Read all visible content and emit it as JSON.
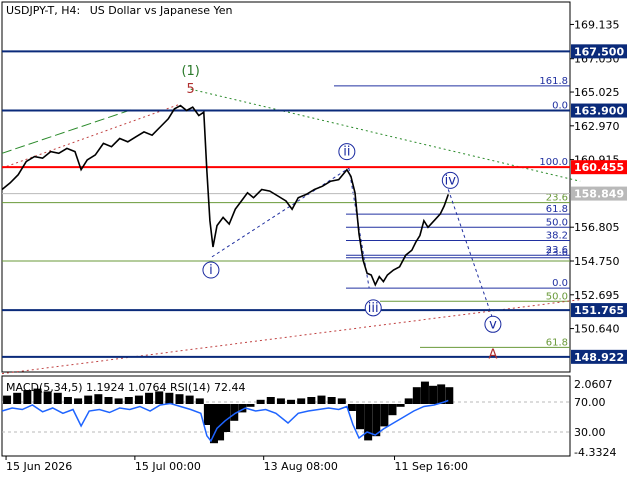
{
  "header": {
    "symbol": "USDJPY-T, H4:",
    "description": "US Dollar vs Japanese Yen"
  },
  "chart_data": {
    "type": "line",
    "title": "USDJPY-T, H4:  US Dollar vs Japanese Yen",
    "price_axis": {
      "ylim": [
        148.0,
        170.5
      ],
      "ticks": [
        {
          "label": "169.135",
          "value": 169.135
        },
        {
          "label": "167.050",
          "value": 167.05
        },
        {
          "label": "165.025",
          "value": 165.025
        },
        {
          "label": "162.970",
          "value": 162.97
        },
        {
          "label": "160.915",
          "value": 160.915
        },
        {
          "label": "156.805",
          "value": 156.805
        },
        {
          "label": "154.750",
          "value": 154.75
        },
        {
          "label": "152.695",
          "value": 152.695
        },
        {
          "label": "150.640",
          "value": 150.64
        }
      ]
    },
    "time_axis": {
      "xlim": [
        0,
        560
      ],
      "ticks": [
        {
          "label": "15 Jun 2026",
          "x": 4
        },
        {
          "label": "15 Jul 00:00",
          "x": 131
        },
        {
          "label": "13 Aug 08:00",
          "x": 258
        },
        {
          "label": "11 Sep 16:00",
          "x": 387
        }
      ]
    },
    "levels": [
      {
        "label": "167.500",
        "value": 167.5,
        "color": "#0a2a7a"
      },
      {
        "label": "163.900",
        "value": 163.9,
        "color": "#0a2a7a"
      },
      {
        "label": "160.455",
        "value": 160.455,
        "color": "#ff0000"
      },
      {
        "label": "158.849",
        "value": 158.849,
        "color": "#b9b9b9"
      },
      {
        "label": "151.765",
        "value": 151.765,
        "color": "#0a2a7a"
      },
      {
        "label": "148.922",
        "value": 148.922,
        "color": "#0a2a7a"
      }
    ],
    "fib_extension": [
      {
        "label": "161.8",
        "value": 165.4
      },
      {
        "label": "0.0",
        "value": 163.9
      },
      {
        "label": "100.0",
        "value": 160.455
      }
    ],
    "fib_retracement": [
      {
        "label": "23.6",
        "value": 158.3
      },
      {
        "label": "61.8",
        "value": 157.6
      },
      {
        "label": "50.0",
        "value": 156.8
      },
      {
        "label": "38.2",
        "value": 156.0
      },
      {
        "label": "23.6",
        "value": 155.1
      },
      {
        "label": "23.6",
        "value": 154.95
      },
      {
        "label": "0.0",
        "value": 153.1
      }
    ],
    "fib_lower": [
      {
        "label": "50.0",
        "value": 152.3
      },
      {
        "label": "61.8",
        "value": 149.5
      }
    ],
    "wave_labels": [
      {
        "text": "(1)",
        "x": 186,
        "y": 166.3,
        "color": "#2a7a2a"
      },
      {
        "text": "5",
        "x": 186,
        "y": 165.2,
        "color": "#b03030"
      },
      {
        "text": "ii",
        "x": 340,
        "y": 161.4,
        "color": "#1a2aa0"
      },
      {
        "text": "i",
        "x": 206,
        "y": 154.2,
        "color": "#1a2aa0"
      },
      {
        "text": "iv",
        "x": 442,
        "y": 159.65,
        "color": "#1a2aa0"
      },
      {
        "text": "iii",
        "x": 366,
        "y": 151.9,
        "color": "#1a2aa0"
      },
      {
        "text": "v",
        "x": 484,
        "y": 150.9,
        "color": "#1a2aa0"
      },
      {
        "text": "A",
        "x": 484,
        "y": 149.05,
        "color": "#b03030"
      }
    ],
    "price_series": [
      {
        "x": 0,
        "y": 159.1
      },
      {
        "x": 8,
        "y": 159.5
      },
      {
        "x": 16,
        "y": 160.0
      },
      {
        "x": 24,
        "y": 160.8
      },
      {
        "x": 32,
        "y": 161.1
      },
      {
        "x": 40,
        "y": 161.0
      },
      {
        "x": 48,
        "y": 161.4
      },
      {
        "x": 56,
        "y": 161.3
      },
      {
        "x": 64,
        "y": 161.6
      },
      {
        "x": 72,
        "y": 161.4
      },
      {
        "x": 78,
        "y": 160.3
      },
      {
        "x": 84,
        "y": 160.9
      },
      {
        "x": 92,
        "y": 161.2
      },
      {
        "x": 100,
        "y": 161.9
      },
      {
        "x": 108,
        "y": 161.7
      },
      {
        "x": 116,
        "y": 162.2
      },
      {
        "x": 124,
        "y": 162.0
      },
      {
        "x": 132,
        "y": 162.3
      },
      {
        "x": 140,
        "y": 162.6
      },
      {
        "x": 148,
        "y": 162.4
      },
      {
        "x": 156,
        "y": 162.9
      },
      {
        "x": 164,
        "y": 163.4
      },
      {
        "x": 170,
        "y": 164.0
      },
      {
        "x": 176,
        "y": 164.2
      },
      {
        "x": 182,
        "y": 163.9
      },
      {
        "x": 188,
        "y": 164.1
      },
      {
        "x": 194,
        "y": 163.6
      },
      {
        "x": 199,
        "y": 163.8
      },
      {
        "x": 202,
        "y": 160.2
      },
      {
        "x": 205,
        "y": 157.2
      },
      {
        "x": 208,
        "y": 155.6
      },
      {
        "x": 212,
        "y": 156.9
      },
      {
        "x": 218,
        "y": 157.4
      },
      {
        "x": 224,
        "y": 157.0
      },
      {
        "x": 230,
        "y": 157.9
      },
      {
        "x": 236,
        "y": 158.4
      },
      {
        "x": 242,
        "y": 158.9
      },
      {
        "x": 248,
        "y": 158.6
      },
      {
        "x": 256,
        "y": 159.1
      },
      {
        "x": 264,
        "y": 159.0
      },
      {
        "x": 272,
        "y": 158.7
      },
      {
        "x": 280,
        "y": 158.4
      },
      {
        "x": 286,
        "y": 157.9
      },
      {
        "x": 292,
        "y": 158.6
      },
      {
        "x": 300,
        "y": 158.8
      },
      {
        "x": 308,
        "y": 159.1
      },
      {
        "x": 316,
        "y": 159.3
      },
      {
        "x": 324,
        "y": 159.6
      },
      {
        "x": 332,
        "y": 159.7
      },
      {
        "x": 340,
        "y": 160.3
      },
      {
        "x": 344,
        "y": 159.9
      },
      {
        "x": 348,
        "y": 158.9
      },
      {
        "x": 352,
        "y": 156.4
      },
      {
        "x": 356,
        "y": 154.8
      },
      {
        "x": 360,
        "y": 154.0
      },
      {
        "x": 364,
        "y": 153.9
      },
      {
        "x": 368,
        "y": 153.3
      },
      {
        "x": 372,
        "y": 153.8
      },
      {
        "x": 376,
        "y": 153.5
      },
      {
        "x": 380,
        "y": 153.9
      },
      {
        "x": 386,
        "y": 154.2
      },
      {
        "x": 392,
        "y": 154.4
      },
      {
        "x": 398,
        "y": 155.1
      },
      {
        "x": 404,
        "y": 155.4
      },
      {
        "x": 408,
        "y": 155.9
      },
      {
        "x": 412,
        "y": 156.3
      },
      {
        "x": 416,
        "y": 157.2
      },
      {
        "x": 420,
        "y": 156.8
      },
      {
        "x": 426,
        "y": 157.2
      },
      {
        "x": 432,
        "y": 157.6
      },
      {
        "x": 436,
        "y": 158.1
      },
      {
        "x": 440,
        "y": 158.8
      }
    ],
    "macd_panel": {
      "label": "MACD(5,34,5) 1.1924 1.0764 RSI(14) 72.44",
      "ticks": [
        {
          "label": "2.0607"
        },
        {
          "label": "70.00"
        },
        {
          "label": "30.00"
        },
        {
          "label": "-4.3324"
        }
      ],
      "histogram": [
        {
          "x": 4,
          "v": 0.6
        },
        {
          "x": 14,
          "v": 0.8
        },
        {
          "x": 24,
          "v": 1.0
        },
        {
          "x": 34,
          "v": 1.1
        },
        {
          "x": 44,
          "v": 0.9
        },
        {
          "x": 54,
          "v": 0.8
        },
        {
          "x": 64,
          "v": 0.5
        },
        {
          "x": 74,
          "v": 0.4
        },
        {
          "x": 84,
          "v": 0.6
        },
        {
          "x": 94,
          "v": 0.7
        },
        {
          "x": 104,
          "v": 0.5
        },
        {
          "x": 114,
          "v": 0.4
        },
        {
          "x": 124,
          "v": 0.5
        },
        {
          "x": 134,
          "v": 0.6
        },
        {
          "x": 144,
          "v": 0.8
        },
        {
          "x": 154,
          "v": 0.9
        },
        {
          "x": 164,
          "v": 0.8
        },
        {
          "x": 174,
          "v": 0.7
        },
        {
          "x": 184,
          "v": 0.6
        },
        {
          "x": 194,
          "v": 0.4
        },
        {
          "x": 202,
          "v": -1.5
        },
        {
          "x": 208,
          "v": -2.8
        },
        {
          "x": 214,
          "v": -2.6
        },
        {
          "x": 220,
          "v": -2.0
        },
        {
          "x": 228,
          "v": -1.2
        },
        {
          "x": 236,
          "v": -0.6
        },
        {
          "x": 244,
          "v": -0.2
        },
        {
          "x": 254,
          "v": 0.3
        },
        {
          "x": 264,
          "v": 0.5
        },
        {
          "x": 274,
          "v": 0.4
        },
        {
          "x": 284,
          "v": 0.3
        },
        {
          "x": 294,
          "v": 0.4
        },
        {
          "x": 304,
          "v": 0.5
        },
        {
          "x": 314,
          "v": 0.6
        },
        {
          "x": 324,
          "v": 0.5
        },
        {
          "x": 334,
          "v": 0.4
        },
        {
          "x": 344,
          "v": -0.5
        },
        {
          "x": 352,
          "v": -1.8
        },
        {
          "x": 360,
          "v": -2.6
        },
        {
          "x": 368,
          "v": -2.3
        },
        {
          "x": 376,
          "v": -1.6
        },
        {
          "x": 384,
          "v": -0.8
        },
        {
          "x": 392,
          "v": -0.2
        },
        {
          "x": 400,
          "v": 0.4
        },
        {
          "x": 408,
          "v": 1.2
        },
        {
          "x": 416,
          "v": 1.6
        },
        {
          "x": 424,
          "v": 1.3
        },
        {
          "x": 432,
          "v": 1.4
        },
        {
          "x": 440,
          "v": 1.2
        }
      ],
      "rsi": [
        {
          "x": 0,
          "v": 58
        },
        {
          "x": 10,
          "v": 62
        },
        {
          "x": 20,
          "v": 60
        },
        {
          "x": 30,
          "v": 66
        },
        {
          "x": 40,
          "v": 57
        },
        {
          "x": 50,
          "v": 62
        },
        {
          "x": 60,
          "v": 55
        },
        {
          "x": 70,
          "v": 60
        },
        {
          "x": 78,
          "v": 38
        },
        {
          "x": 86,
          "v": 58
        },
        {
          "x": 96,
          "v": 60
        },
        {
          "x": 106,
          "v": 56
        },
        {
          "x": 116,
          "v": 62
        },
        {
          "x": 126,
          "v": 60
        },
        {
          "x": 136,
          "v": 64
        },
        {
          "x": 146,
          "v": 58
        },
        {
          "x": 156,
          "v": 66
        },
        {
          "x": 166,
          "v": 68
        },
        {
          "x": 176,
          "v": 64
        },
        {
          "x": 186,
          "v": 60
        },
        {
          "x": 196,
          "v": 55
        },
        {
          "x": 202,
          "v": 25
        },
        {
          "x": 206,
          "v": 18
        },
        {
          "x": 212,
          "v": 35
        },
        {
          "x": 220,
          "v": 45
        },
        {
          "x": 230,
          "v": 55
        },
        {
          "x": 240,
          "v": 62
        },
        {
          "x": 250,
          "v": 58
        },
        {
          "x": 260,
          "v": 60
        },
        {
          "x": 270,
          "v": 55
        },
        {
          "x": 282,
          "v": 42
        },
        {
          "x": 292,
          "v": 55
        },
        {
          "x": 302,
          "v": 58
        },
        {
          "x": 312,
          "v": 60
        },
        {
          "x": 322,
          "v": 62
        },
        {
          "x": 332,
          "v": 60
        },
        {
          "x": 340,
          "v": 64
        },
        {
          "x": 346,
          "v": 40
        },
        {
          "x": 352,
          "v": 22
        },
        {
          "x": 360,
          "v": 30
        },
        {
          "x": 368,
          "v": 26
        },
        {
          "x": 376,
          "v": 34
        },
        {
          "x": 386,
          "v": 42
        },
        {
          "x": 396,
          "v": 50
        },
        {
          "x": 406,
          "v": 58
        },
        {
          "x": 416,
          "v": 64
        },
        {
          "x": 426,
          "v": 66
        },
        {
          "x": 436,
          "v": 70
        },
        {
          "x": 440,
          "v": 72
        }
      ]
    }
  }
}
